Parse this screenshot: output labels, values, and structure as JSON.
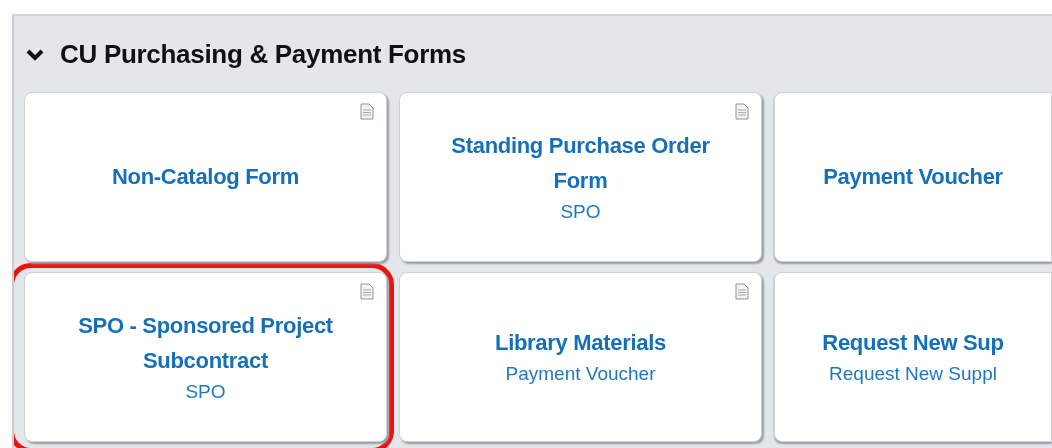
{
  "section": {
    "title": "CU Purchasing & Payment Forms",
    "expanded": true
  },
  "forms": [
    {
      "title": "Non-Catalog Form",
      "document_icon": true,
      "highlighted": false
    },
    {
      "title": "Standing Purchase Order Form",
      "subtitle": "SPO",
      "document_icon": true,
      "highlighted": false
    },
    {
      "title": "Payment Voucher",
      "document_icon": false,
      "highlighted": false
    },
    {
      "title": "SPO - Sponsored Project Subcontract",
      "subtitle": "SPO",
      "document_icon": true,
      "highlighted": true
    },
    {
      "title": "Library Materials",
      "subtitle": "Payment Voucher",
      "document_icon": true,
      "highlighted": false
    },
    {
      "title": "Request New Sup",
      "subtitle": "Request New Suppl",
      "document_icon": false,
      "highlighted": false
    }
  ]
}
